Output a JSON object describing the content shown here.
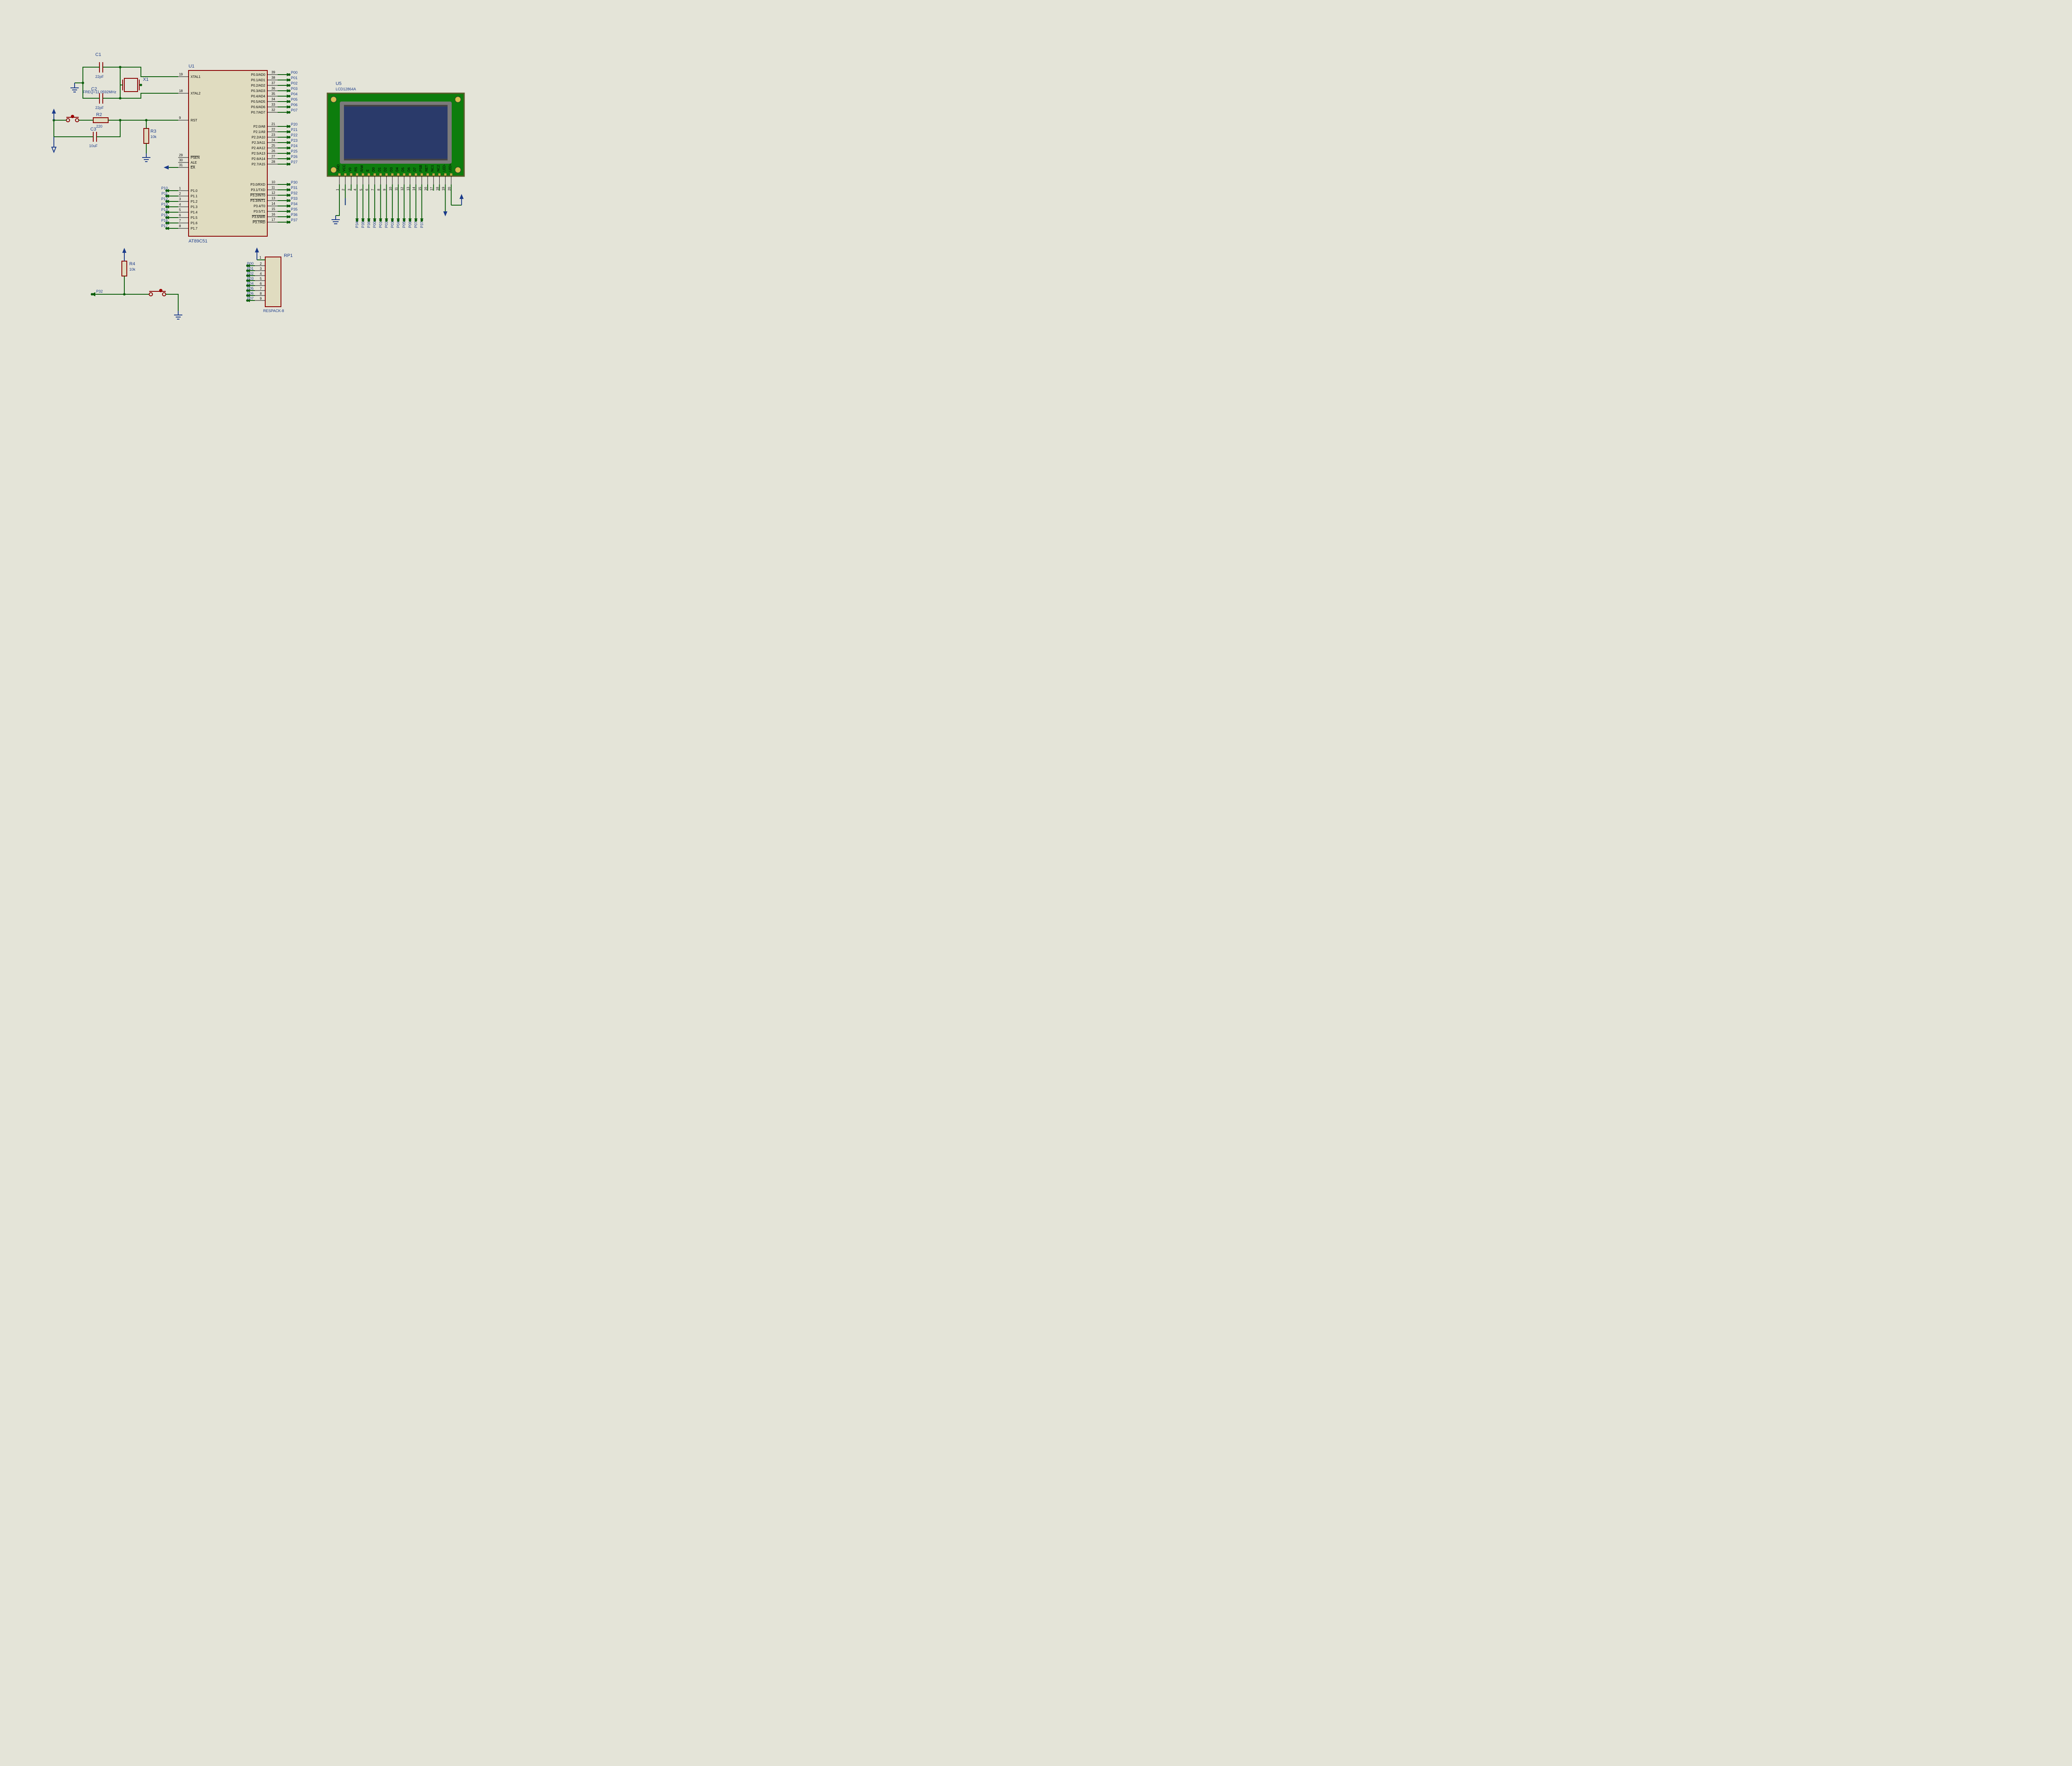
{
  "components": {
    "C1": {
      "ref": "C1",
      "value": "22pF"
    },
    "C2": {
      "ref": "C2",
      "value": "22pF"
    },
    "C3": {
      "ref": "C3",
      "value": "10uF"
    },
    "X1": {
      "ref": "X1",
      "value": "FREQ=11.0592MHz"
    },
    "R2": {
      "ref": "R2",
      "value": "220"
    },
    "R3": {
      "ref": "R3",
      "value": "10k"
    },
    "R4": {
      "ref": "R4",
      "value": "10k"
    },
    "U1": {
      "ref": "U1",
      "value": "AT89C51"
    },
    "U5": {
      "ref": "U5",
      "value": "LCD12864A"
    },
    "RP1": {
      "ref": "RP1",
      "value": "RESPACK-8"
    }
  },
  "U1_pins": {
    "left": [
      {
        "num": "19",
        "name": "XTAL1"
      },
      {
        "num": "18",
        "name": "XTAL2"
      },
      {
        "num": "9",
        "name": "RST"
      },
      {
        "num": "29",
        "name": "PSEN",
        "inv": true
      },
      {
        "num": "30",
        "name": "ALE"
      },
      {
        "num": "31",
        "name": "EA",
        "inv": true
      },
      {
        "num": "1",
        "name": "P1.0"
      },
      {
        "num": "2",
        "name": "P1.1"
      },
      {
        "num": "3",
        "name": "P1.2"
      },
      {
        "num": "4",
        "name": "P1.3"
      },
      {
        "num": "5",
        "name": "P1.4"
      },
      {
        "num": "6",
        "name": "P1.5"
      },
      {
        "num": "7",
        "name": "P1.6"
      },
      {
        "num": "8",
        "name": "P1.7"
      }
    ],
    "right": [
      {
        "num": "39",
        "name": "P0.0/AD0",
        "net": "P00"
      },
      {
        "num": "38",
        "name": "P0.1/AD1",
        "net": "P01"
      },
      {
        "num": "37",
        "name": "P0.2/AD2",
        "net": "P02"
      },
      {
        "num": "36",
        "name": "P0.3/AD3",
        "net": "P03"
      },
      {
        "num": "35",
        "name": "P0.4/AD4",
        "net": "P04"
      },
      {
        "num": "34",
        "name": "P0.5/AD5",
        "net": "P05"
      },
      {
        "num": "33",
        "name": "P0.6/AD6",
        "net": "P06"
      },
      {
        "num": "32",
        "name": "P0.7/AD7",
        "net": "P07"
      },
      {
        "num": "21",
        "name": "P2.0/A8",
        "net": "P20"
      },
      {
        "num": "22",
        "name": "P2.1/A9",
        "net": "P21"
      },
      {
        "num": "23",
        "name": "P2.2/A10",
        "net": "P22"
      },
      {
        "num": "24",
        "name": "P2.3/A11",
        "net": "P23"
      },
      {
        "num": "25",
        "name": "P2.4/A12",
        "net": "P24"
      },
      {
        "num": "26",
        "name": "P2.5/A13",
        "net": "P25"
      },
      {
        "num": "27",
        "name": "P2.6/A14",
        "net": "P26"
      },
      {
        "num": "28",
        "name": "P2.7/A15",
        "net": "P27"
      },
      {
        "num": "10",
        "name": "P3.0/RXD",
        "net": "P30"
      },
      {
        "num": "11",
        "name": "P3.1/TXD",
        "net": "P31"
      },
      {
        "num": "12",
        "name": "P3.2/INT0",
        "net": "P32",
        "inv": true
      },
      {
        "num": "13",
        "name": "P3.3/INT1",
        "net": "P33",
        "inv": true
      },
      {
        "num": "14",
        "name": "P3.4/T0",
        "net": "P34"
      },
      {
        "num": "15",
        "name": "P3.5/T1",
        "net": "P35"
      },
      {
        "num": "16",
        "name": "P3.6/WR",
        "net": "P36",
        "inv": true
      },
      {
        "num": "17",
        "name": "P3.7/RD",
        "net": "P37",
        "inv": true
      }
    ]
  },
  "U1_P1_nets": [
    "P10",
    "P11",
    "P12",
    "P13",
    "P14",
    "P15",
    "P16",
    "P17"
  ],
  "RP1_inputs": [
    "P00",
    "P01",
    "P02",
    "P03",
    "P04",
    "P05",
    "P06",
    "P07"
  ],
  "RP1_pin_nums": [
    "1",
    "2",
    "3",
    "4",
    "5",
    "6",
    "7",
    "8",
    "9"
  ],
  "U5_pins": {
    "names": [
      "GND",
      "VCC",
      "V0",
      "RS",
      "R/W",
      "E",
      "D0",
      "D1",
      "D2",
      "D3",
      "D4",
      "D5",
      "D6",
      "D7",
      "PSB",
      "RET",
      "NC1",
      "NC2",
      "LED-",
      "LED+"
    ],
    "nums": [
      "1",
      "2",
      "3",
      "4",
      "5",
      "6",
      "7",
      "8",
      "9",
      "10",
      "11",
      "12",
      "13",
      "14",
      "15",
      "16",
      "17",
      "18",
      "19",
      "20"
    ],
    "nets": [
      "",
      "",
      "",
      "P34",
      "P35",
      "P36",
      "P00",
      "P01",
      "P02",
      "P03",
      "P04",
      "P05",
      "P06",
      "P07",
      "P37",
      "",
      "",
      "",
      "",
      ""
    ]
  },
  "net_P32": "P32"
}
